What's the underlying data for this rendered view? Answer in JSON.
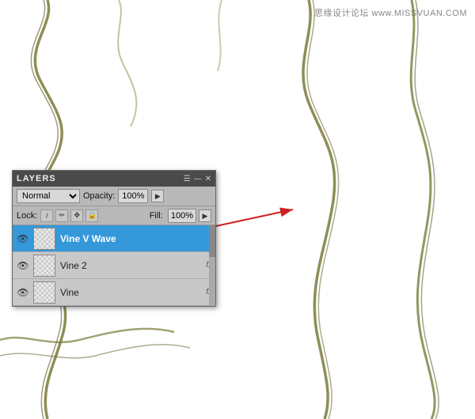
{
  "watermark": {
    "text": "思缘设计论坛 www.MISSVUAN.COM"
  },
  "layers_panel": {
    "title": "LAYERS",
    "blend_mode": "Normal",
    "opacity_label": "Opacity:",
    "opacity_value": "100%",
    "lock_label": "Lock:",
    "fill_label": "Fill:",
    "fill_value": "100%",
    "layers": [
      {
        "name": "Vine V Wave",
        "active": true,
        "fx": ""
      },
      {
        "name": "Vine 2",
        "active": false,
        "fx": "fx"
      },
      {
        "name": "Vine",
        "active": false,
        "fx": "fx"
      }
    ]
  },
  "icons": {
    "eye": "👁",
    "lock": "🔒",
    "pencil": "✏",
    "plus": "+",
    "move": "✥",
    "menu": "☰",
    "close": "✕",
    "dash": "—",
    "chevron_down": "▾",
    "arrow_right": "▶"
  }
}
